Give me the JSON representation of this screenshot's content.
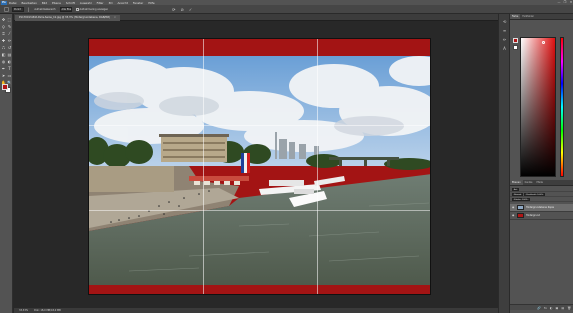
{
  "menubar": {
    "logo": "Ps",
    "items": [
      "Datei",
      "Bearbeiten",
      "Bild",
      "Ebene",
      "Schrift",
      "Auswahl",
      "Filter",
      "3D",
      "Ansicht",
      "Fenster",
      "Hilfe"
    ],
    "window_controls": [
      "—",
      "❐",
      "✕"
    ]
  },
  "options": {
    "tool_preset": "",
    "sample_size": "Punkt",
    "sample_label": "Aufnahmebereich",
    "sample_all_layers": "Alle Ebenen",
    "show_sampling_ring": "Aufnahmering anzeigen"
  },
  "document": {
    "tab_title": "P1170013-Bild-Paris-Seine_11.jpg @ 33,3% (Hintergrundebene, RGB/8#)",
    "close_glyph": "×",
    "colors": {
      "band": "#a31414",
      "photo_sky": "#7fb0e0",
      "water": "#5e6a5a"
    }
  },
  "status": {
    "zoom": "33,33%",
    "doc_info": "Dok: 18,0 MB/18,0 MB"
  },
  "panels": {
    "color_tabs": [
      "Farbe",
      "Farbfelder"
    ],
    "layer_tabs": [
      "Ebenen",
      "Kanäle",
      "Pfade"
    ],
    "blend_mode": "Normal",
    "opacity_label": "Deckkraft: 100%",
    "fill_label": "Fläche: 100%",
    "kind_filter": "Art",
    "layers": [
      {
        "name": "Hintergrundebene Kopie",
        "active": true
      },
      {
        "name": "Hintergrund",
        "active": false
      }
    ],
    "footer_icons": [
      "🔗",
      "fx",
      "◐",
      "▣",
      "▤",
      "🗑"
    ],
    "foreground_color": "#b01515",
    "background_color": "#ffffff"
  },
  "tools": [
    {
      "name": "move-tool-icon",
      "glyph": "✥"
    },
    {
      "name": "marquee-tool-icon",
      "glyph": "⬚"
    },
    {
      "name": "lasso-tool-icon",
      "glyph": "ϙ"
    },
    {
      "name": "quick-select-tool-icon",
      "glyph": "✎"
    },
    {
      "name": "crop-tool-icon",
      "glyph": "⌗"
    },
    {
      "name": "eyedropper-tool-icon",
      "glyph": "⁄"
    },
    {
      "name": "healing-tool-icon",
      "glyph": "✚"
    },
    {
      "name": "brush-tool-icon",
      "glyph": "✏"
    },
    {
      "name": "stamp-tool-icon",
      "glyph": "⎍"
    },
    {
      "name": "history-brush-tool-icon",
      "glyph": "↺"
    },
    {
      "name": "eraser-tool-icon",
      "glyph": "◧"
    },
    {
      "name": "gradient-tool-icon",
      "glyph": "▤"
    },
    {
      "name": "blur-tool-icon",
      "glyph": "◍"
    },
    {
      "name": "dodge-tool-icon",
      "glyph": "◐"
    },
    {
      "name": "pen-tool-icon",
      "glyph": "✒"
    },
    {
      "name": "type-tool-icon",
      "glyph": "T"
    },
    {
      "name": "path-select-tool-icon",
      "glyph": "➤"
    },
    {
      "name": "shape-tool-icon",
      "glyph": "▭"
    },
    {
      "name": "hand-tool-icon",
      "glyph": "✋"
    },
    {
      "name": "zoom-tool-icon",
      "glyph": "🔍"
    }
  ],
  "mini_dock": [
    {
      "name": "history-panel-icon",
      "glyph": "⟲"
    },
    {
      "name": "properties-panel-icon",
      "glyph": "≡"
    },
    {
      "name": "brushes-panel-icon",
      "glyph": "✏"
    },
    {
      "name": "character-panel-icon",
      "glyph": "A"
    }
  ]
}
